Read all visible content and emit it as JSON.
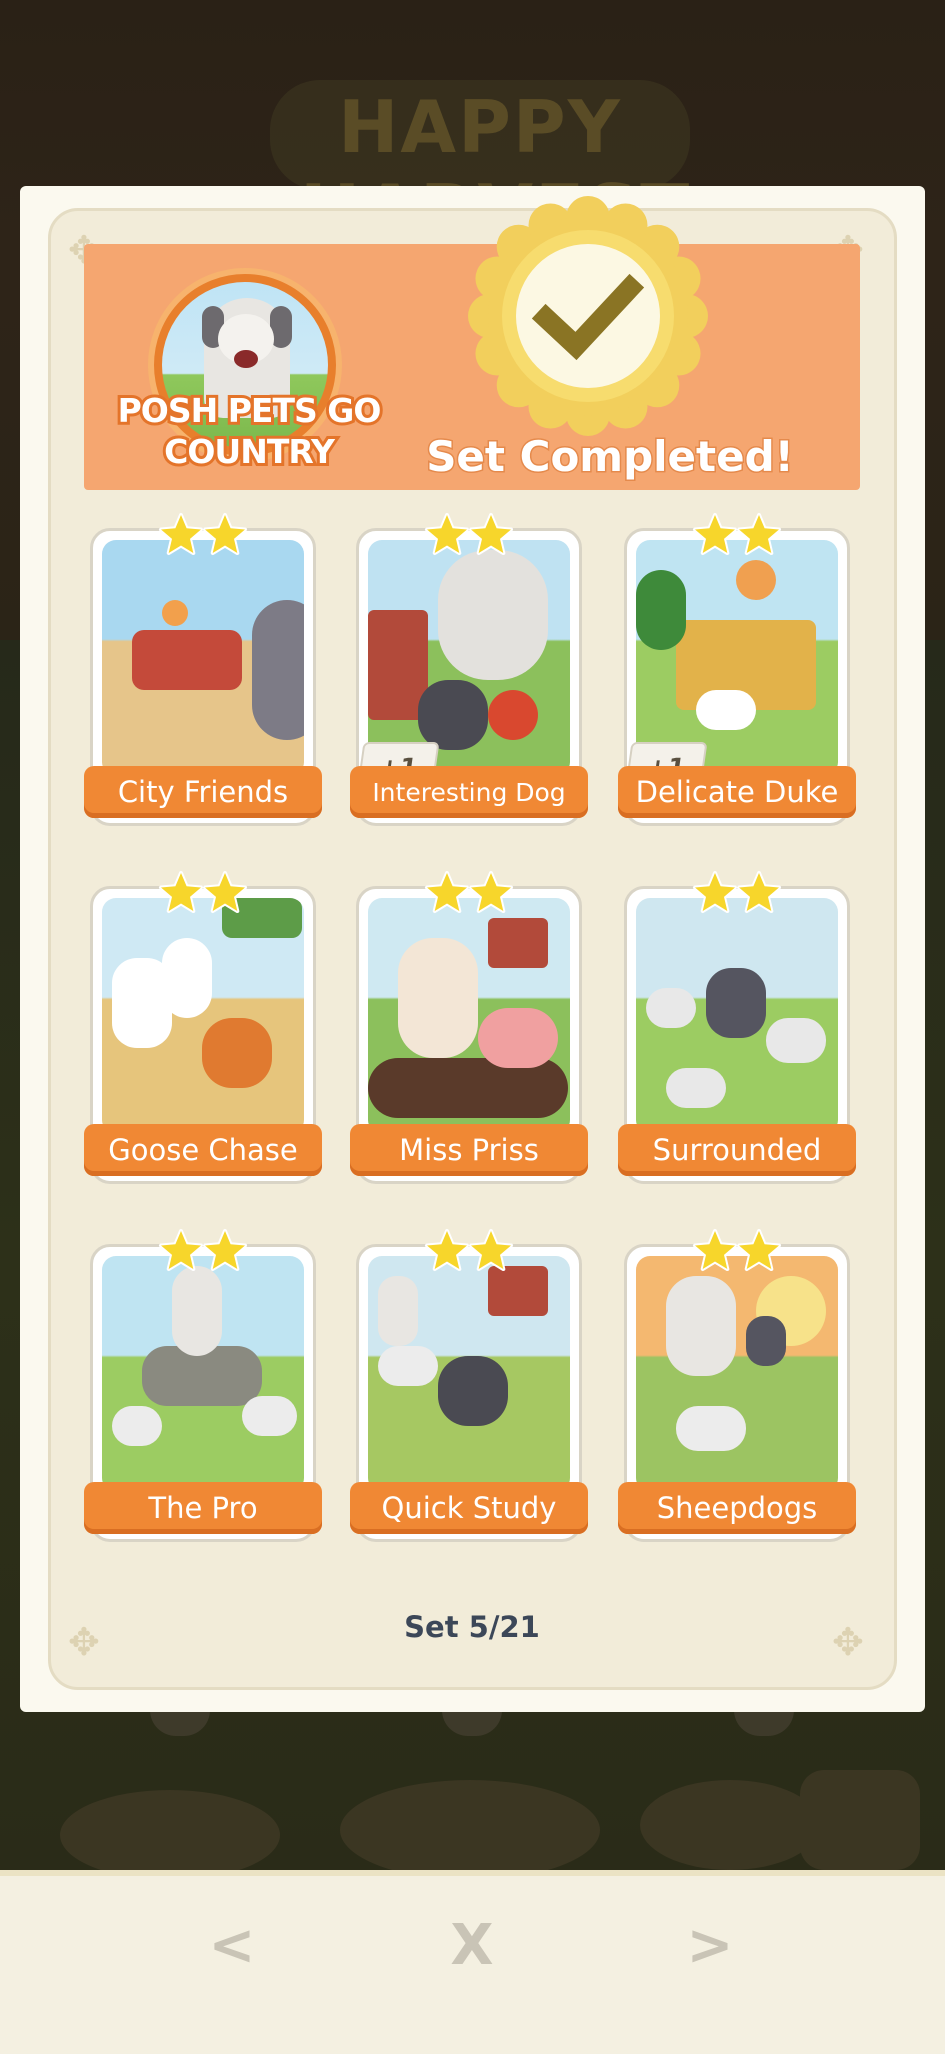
{
  "background": {
    "banner_text": "HAPPY HARVEST"
  },
  "set": {
    "title": "POSH PETS GO COUNTRY",
    "status": "Set Completed!",
    "counter": "Set 5/21"
  },
  "colors": {
    "header_orange": "#f5a670",
    "label_orange": "#f08834",
    "seal_gold": "#f2cf5c",
    "check_olive": "#8a7424",
    "star_yellow": "#f7d62b"
  },
  "cards": [
    {
      "name": "City Friends",
      "stars": 2,
      "extra": ""
    },
    {
      "name": "Interesting Dog",
      "stars": 2,
      "extra": "+1"
    },
    {
      "name": "Delicate Duke",
      "stars": 2,
      "extra": "+1"
    },
    {
      "name": "Goose Chase",
      "stars": 2,
      "extra": ""
    },
    {
      "name": "Miss Priss",
      "stars": 2,
      "extra": ""
    },
    {
      "name": "Surrounded",
      "stars": 2,
      "extra": ""
    },
    {
      "name": "The Pro",
      "stars": 2,
      "extra": ""
    },
    {
      "name": "Quick Study",
      "stars": 2,
      "extra": ""
    },
    {
      "name": "Sheepdogs",
      "stars": 2,
      "extra": ""
    }
  ],
  "nav": {
    "prev": "<",
    "close": "X",
    "next": ">"
  },
  "icons": [
    "check-icon",
    "star-icon",
    "chevron-left-icon",
    "close-icon",
    "chevron-right-icon"
  ]
}
